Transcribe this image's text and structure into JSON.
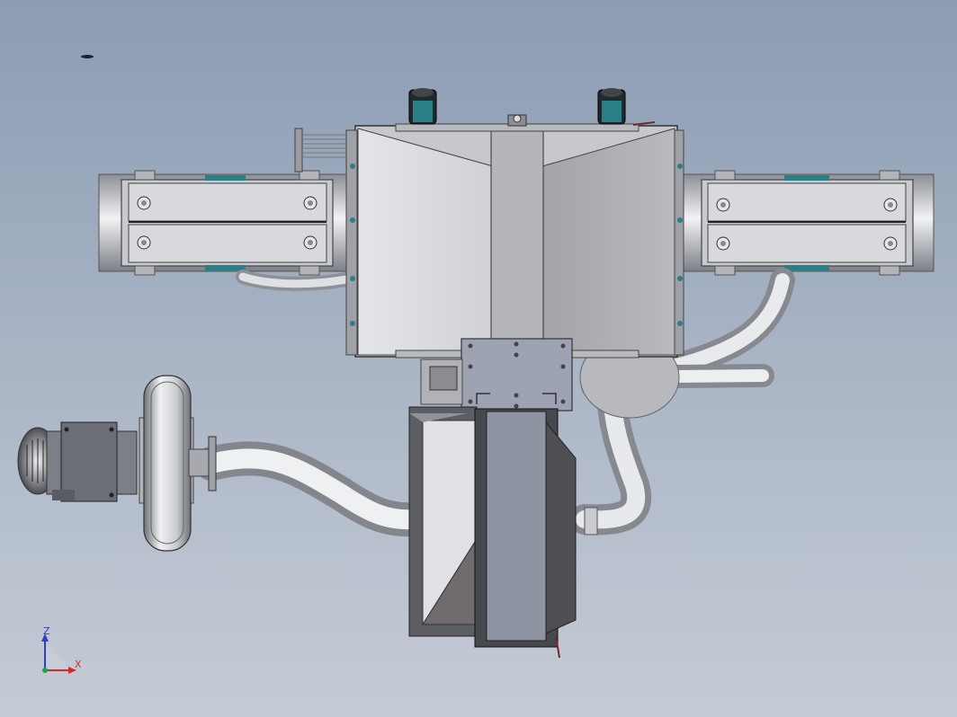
{
  "triad": {
    "z_label": "Z",
    "x_label": "X",
    "z_color": "#2a3fd6",
    "x_color": "#d62a2a",
    "origin_color": "#1aa84a"
  },
  "colors": {
    "background_top": "#8b9cb3",
    "background_bottom": "#c6ccd6",
    "steel_light": "#d9dbe0",
    "steel_mid": "#a9acb3",
    "steel_dark": "#6e7178",
    "teal_accent": "#2a7f86"
  }
}
